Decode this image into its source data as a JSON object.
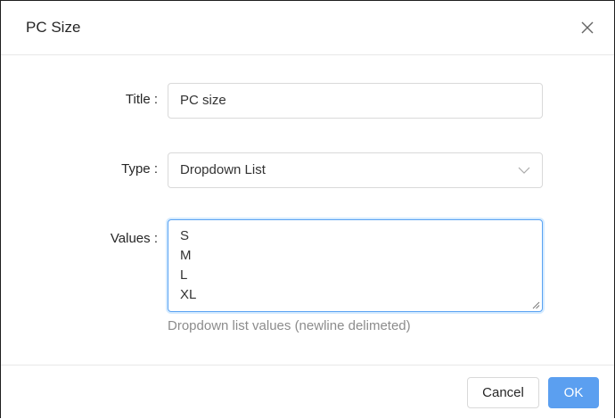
{
  "dialog": {
    "title": "PC Size",
    "close_icon": "close-icon"
  },
  "form": {
    "title_field": {
      "label": "Title",
      "colon": ":",
      "value": "PC size"
    },
    "type_field": {
      "label": "Type",
      "colon": ":",
      "selected": "Dropdown List",
      "arrow_icon": "chevron-down-icon"
    },
    "values_field": {
      "label": "Values",
      "colon": ":",
      "lines": [
        "S",
        "M",
        "L",
        "XL"
      ],
      "help": "Dropdown list values (newline delimeted)"
    }
  },
  "footer": {
    "cancel_label": "Cancel",
    "ok_label": "OK"
  },
  "colors": {
    "accent": "#5b9ff0",
    "focus_border": "#5aa2f2",
    "help_text": "#8c8c8c"
  }
}
